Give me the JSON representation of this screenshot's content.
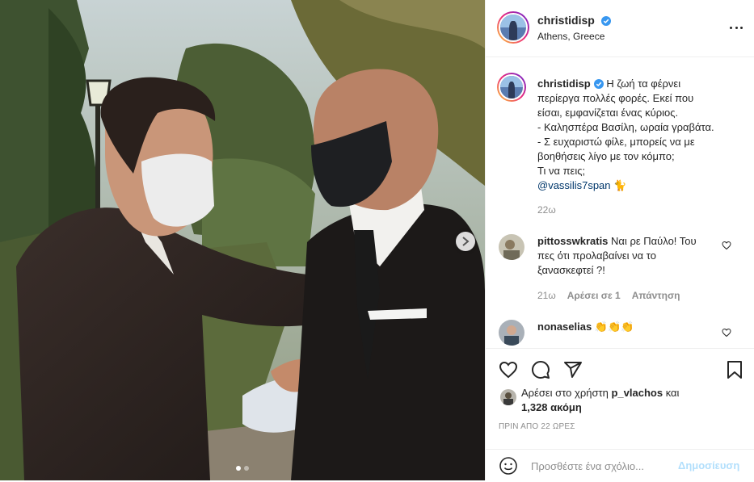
{
  "post": {
    "username": "christidisp",
    "location": "Athens, Greece",
    "caption_lines": [
      "Η ζωή τα φέρνει",
      "περίεργα πολλές φορές. Εκεί που",
      "είσαι, εμφανίζεται ένας κύριος.",
      "- Καλησπέρα Βασίλη, ωραία γραβάτα.",
      "- Σ ευχαριστώ φίλε, μπορείς να με",
      "βοηθήσεις λίγο με τον κόμπο;",
      "Τι να πεις;"
    ],
    "mention": "@vassilis7span",
    "caption_emoji": "🐈",
    "caption_age": "22ω",
    "icons": {
      "verified": "verified-badge-icon",
      "more": "more-options-icon",
      "next": "chevron-right-icon"
    },
    "accent_color": "#0095f6"
  },
  "comments": [
    {
      "username": "pittosswkratis",
      "text_lines": [
        "Ναι ρε Παύλο! Του",
        "πες ότι προλαβαίνει να το",
        "ξανασκεφτεί ?!"
      ],
      "age": "21ω",
      "likes_label": "Αρέσει σε 1",
      "reply_label": "Απάντηση"
    },
    {
      "username": "nonaselias",
      "text": "👏👏👏"
    }
  ],
  "likes": {
    "prefix": "Αρέσει στο χρήστη",
    "user": "p_vlachos",
    "and": "και",
    "count": "1,328 ακόμη"
  },
  "timestamp": "ΠΡΙΝ ΑΠΟ 22 ΩΡΕΣ",
  "add_comment": {
    "placeholder": "Προσθέστε ένα σχόλιο...",
    "post_label": "Δημοσίευση",
    "emoji_icon": "smiley-icon"
  },
  "carousel": {
    "total": 2,
    "active": 1
  }
}
